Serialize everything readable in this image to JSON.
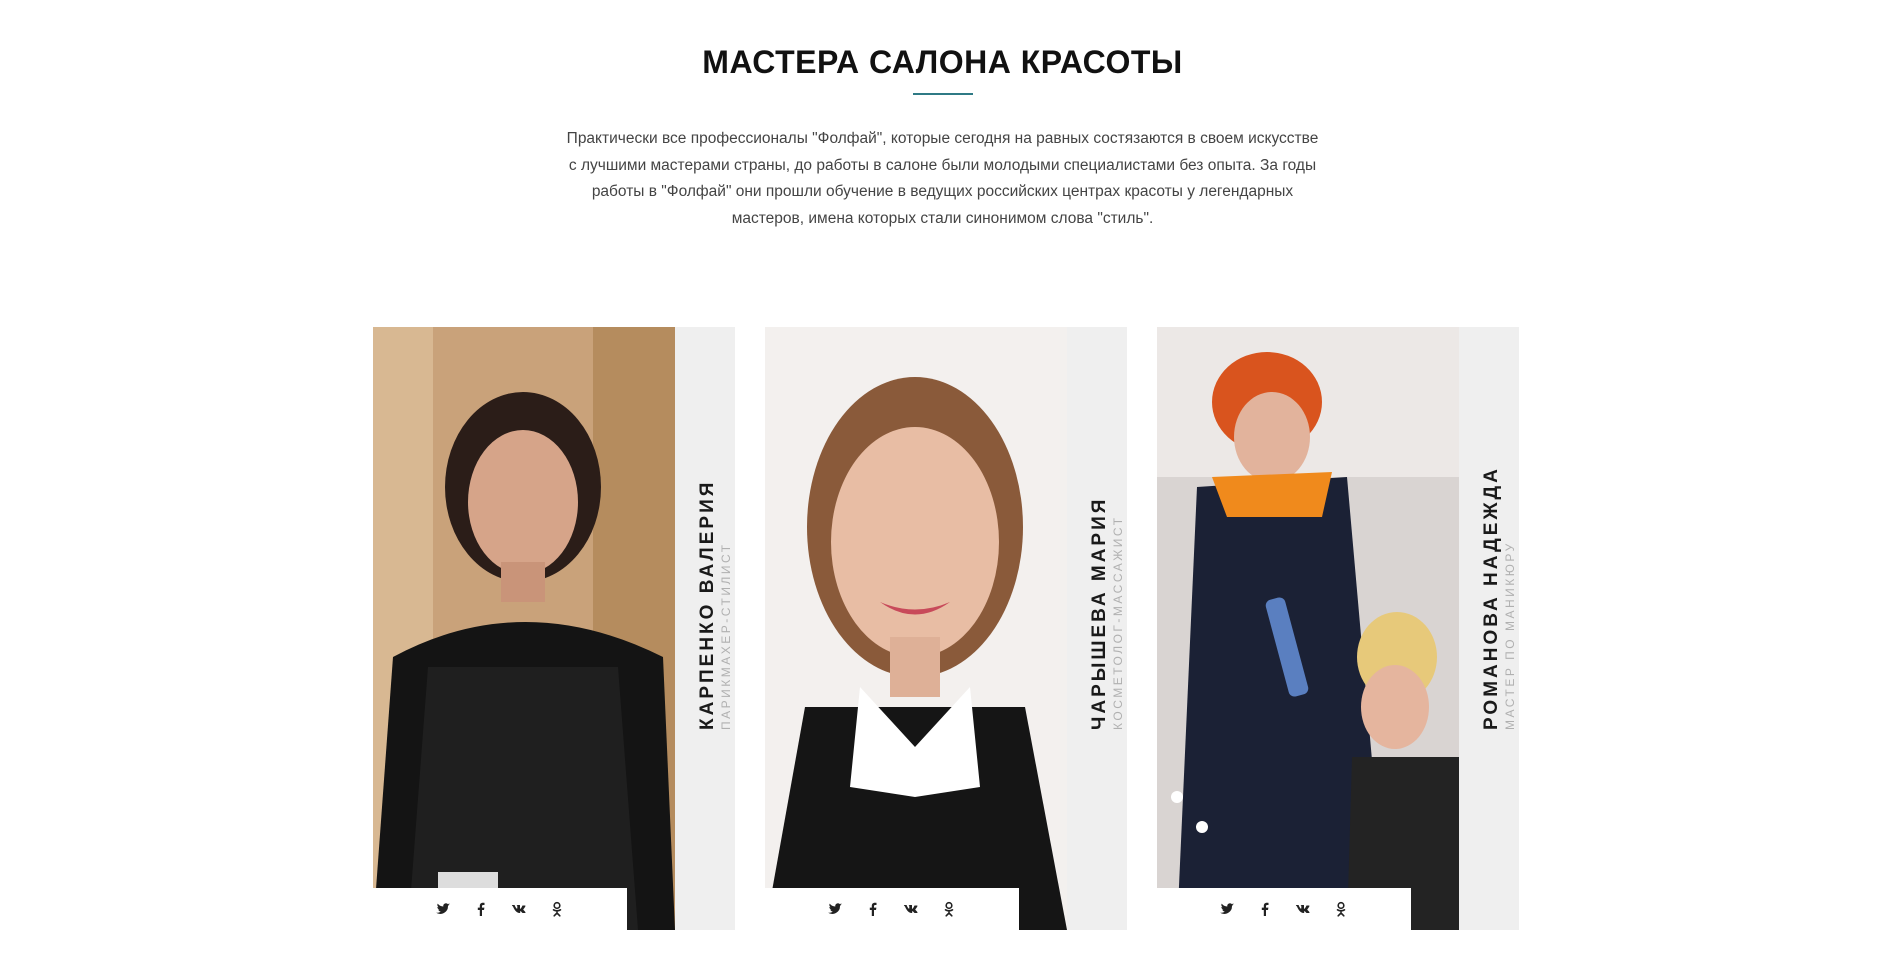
{
  "section": {
    "title": "МАСТЕРА САЛОНА КРАСОТЫ",
    "intro": "Практически все профессионалы \"Фолфай\", которые сегодня на равных состязаются в своем искусстве с лучшими мастерами страны, до работы в салоне были молодыми специалистами без опыта. За годы работы в \"Фолфай\" они прошли обучение в ведущих российских центрах красоты у легендарных мастеров, имена которых стали синонимом слова \"стиль\"."
  },
  "masters": [
    {
      "name": "КАРПЕНКО ВАЛЕРИЯ",
      "role": "ПАРИКМАХЕР-СТИЛИСТ"
    },
    {
      "name": "ЧАРЫШЕВА МАРИЯ",
      "role": "КОСМЕТОЛОГ-МАССАЖИСТ"
    },
    {
      "name": "РОМАНОВА НАДЕЖДА",
      "role": "МАСТЕР ПО МАНИКЮРУ"
    }
  ],
  "social_icons": [
    "twitter-icon",
    "facebook-icon",
    "vk-icon",
    "odnoklassniki-icon"
  ],
  "colors": {
    "accent": "#2f7a85",
    "sidebar": "#efefef",
    "role_text": "#b0b0b0"
  }
}
